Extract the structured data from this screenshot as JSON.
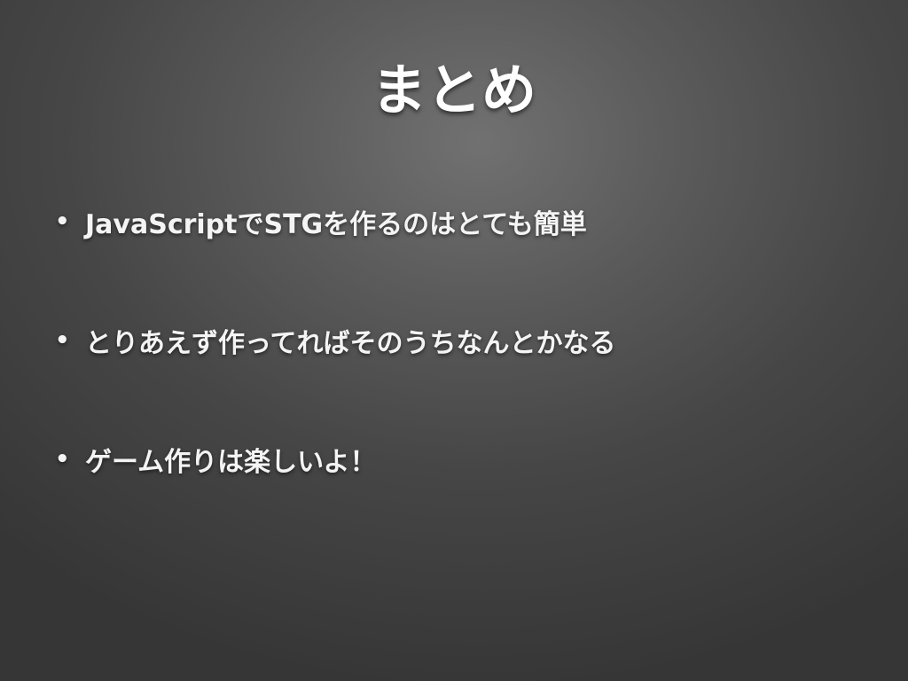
{
  "slide": {
    "title": "まとめ",
    "bullet_symbol": "•",
    "bullets": [
      "JavaScriptでSTGを作るのはとても簡単",
      "とりあえず作ってればそのうちなんとかなる",
      "ゲーム作りは楽しいよ！"
    ]
  }
}
